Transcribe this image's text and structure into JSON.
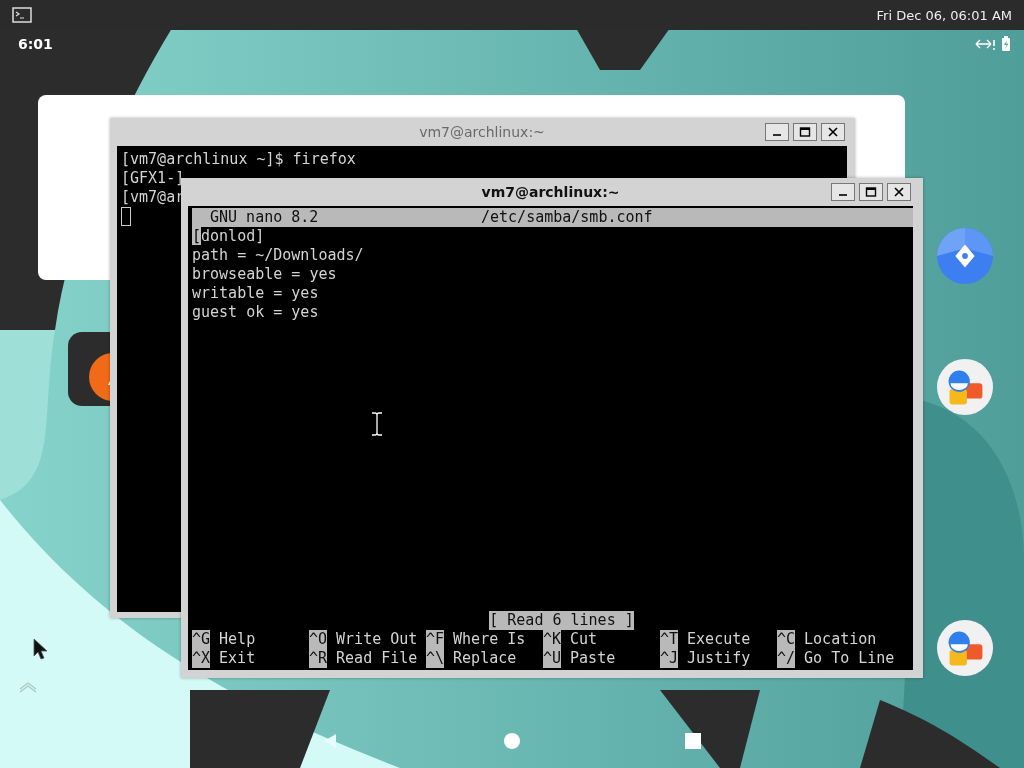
{
  "status_bar": {
    "date_time": "Fri Dec 06, 06:01 AM",
    "clock": "6:01"
  },
  "back_terminal": {
    "title": "vm7@archlinux:~",
    "active": false,
    "cursor": true,
    "lines": [
      "[vm7@archlinux ~]$ firefox",
      "[GFX1-]",
      "[vm7@ar"
    ]
  },
  "nano_window": {
    "title": "vm7@archlinux:~",
    "active": true,
    "header": {
      "app": "GNU nano 8.2",
      "file": "/etc/samba/smb.conf"
    },
    "lines": [
      {
        "text": "[donlod]",
        "cursor": true
      },
      {
        "text": "path = ~/Downloads/",
        "cursor": false
      },
      {
        "text": "browseable = yes",
        "cursor": false
      },
      {
        "text": "writable = yes",
        "cursor": false
      },
      {
        "text": "guest ok = yes",
        "cursor": false
      }
    ],
    "status": "[ Read 6 lines ]",
    "shortcut_rows": [
      [
        {
          "key": "^G",
          "label": "Help"
        },
        {
          "key": "^O",
          "label": "Write Out"
        },
        {
          "key": "^F",
          "label": "Where Is"
        },
        {
          "key": "^K",
          "label": "Cut"
        },
        {
          "key": "^T",
          "label": "Execute"
        },
        {
          "key": "^C",
          "label": "Location"
        }
      ],
      [
        {
          "key": "^X",
          "label": "Exit"
        },
        {
          "key": "^R",
          "label": "Read File"
        },
        {
          "key": "^\\",
          "label": "Replace"
        },
        {
          "key": "^U",
          "label": "Paste"
        },
        {
          "key": "^J",
          "label": "Justify"
        },
        {
          "key": "^/",
          "label": "Go To Line"
        }
      ]
    ]
  }
}
